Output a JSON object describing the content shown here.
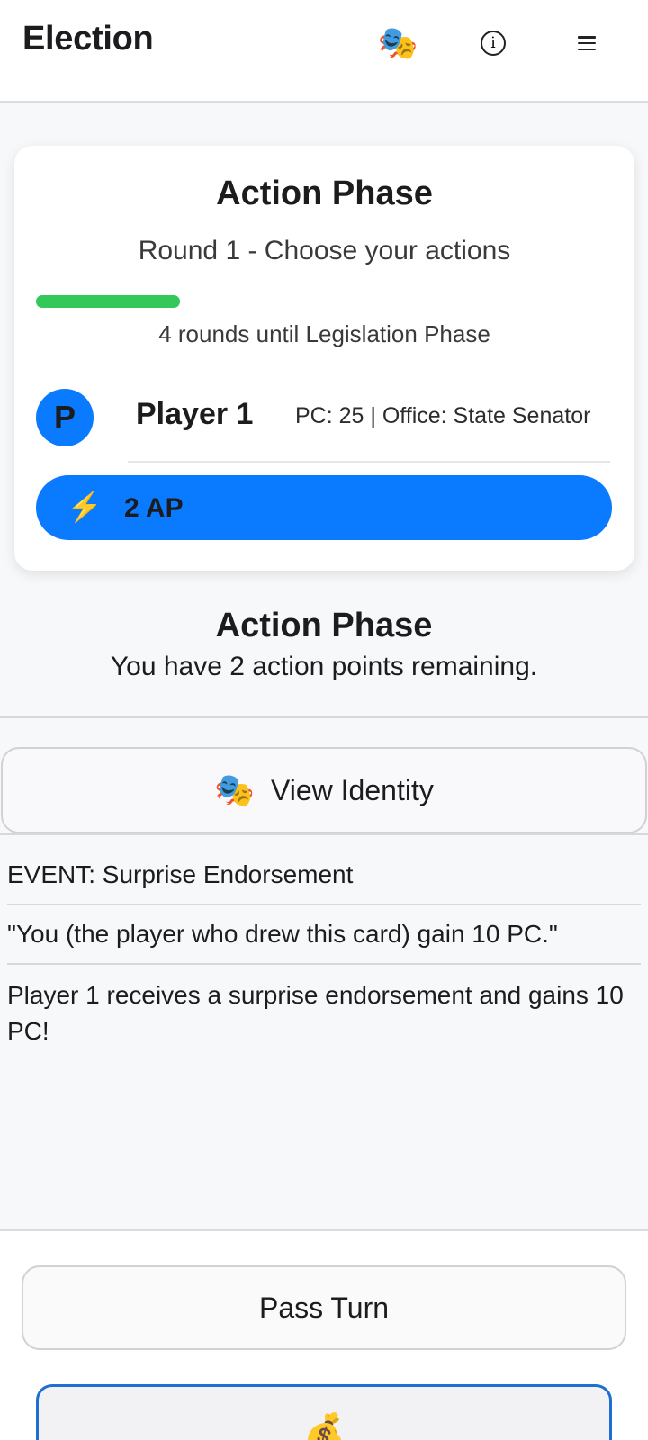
{
  "header": {
    "title": "Election",
    "identity_icon": "🎭",
    "info_icon": "info-icon",
    "menu_icon": "menu-icon"
  },
  "phase_card": {
    "title": "Action Phase",
    "subtitle": "Round 1 - Choose your actions",
    "progress": 0.25,
    "progress_color": "#34c759",
    "rounds_note": "4 rounds until Legislation Phase",
    "player": {
      "initial": "P",
      "name": "Player 1",
      "meta": "PC: 25 | Office: State Senator"
    },
    "ap": {
      "icon": "⚡",
      "label": "2 AP"
    }
  },
  "phase_info": {
    "heading": "Action Phase",
    "description": "You have 2 action points remaining."
  },
  "identity_button": {
    "icon": "🎭",
    "label": "View Identity"
  },
  "event": {
    "title": "EVENT: Surprise Endorsement",
    "quote": "\"You (the player who drew this card) gain 10 PC.\"",
    "result": "Player 1 receives a surprise endorsement and gains 10 PC!"
  },
  "footer": {
    "pass_label": "Pass Turn",
    "action_icon": "💰"
  },
  "colors": {
    "accent": "#0a7aff",
    "success": "#34c759"
  }
}
